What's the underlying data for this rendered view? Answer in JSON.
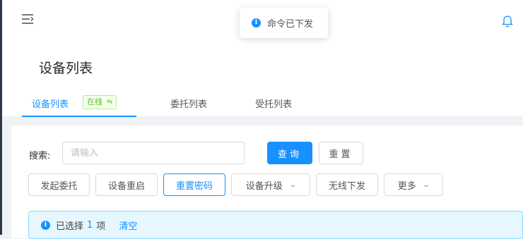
{
  "toast": {
    "message": "命令已下发"
  },
  "page": {
    "title": "设备列表"
  },
  "tabs": [
    {
      "label": "设备列表",
      "active": true
    },
    {
      "label": "委托列表",
      "active": false
    },
    {
      "label": "受托列表",
      "active": false
    }
  ],
  "status_tag": {
    "label": "在线",
    "icon": "swap-icon"
  },
  "search": {
    "label": "搜索:",
    "placeholder": "请输入",
    "value": ""
  },
  "buttons": {
    "query": "查询",
    "reset": "重置",
    "delegate": "发起委托",
    "restart": "设备重启",
    "reset_password": "重置密码",
    "upgrade": "设备升级",
    "wireless": "无线下发",
    "more": "更多"
  },
  "selection": {
    "prefix": "已选择",
    "count": "1",
    "suffix": "项",
    "clear": "清空"
  },
  "colors": {
    "accent": "#1890ff",
    "success": "#52c41a",
    "sidebar": "#2e3848"
  }
}
